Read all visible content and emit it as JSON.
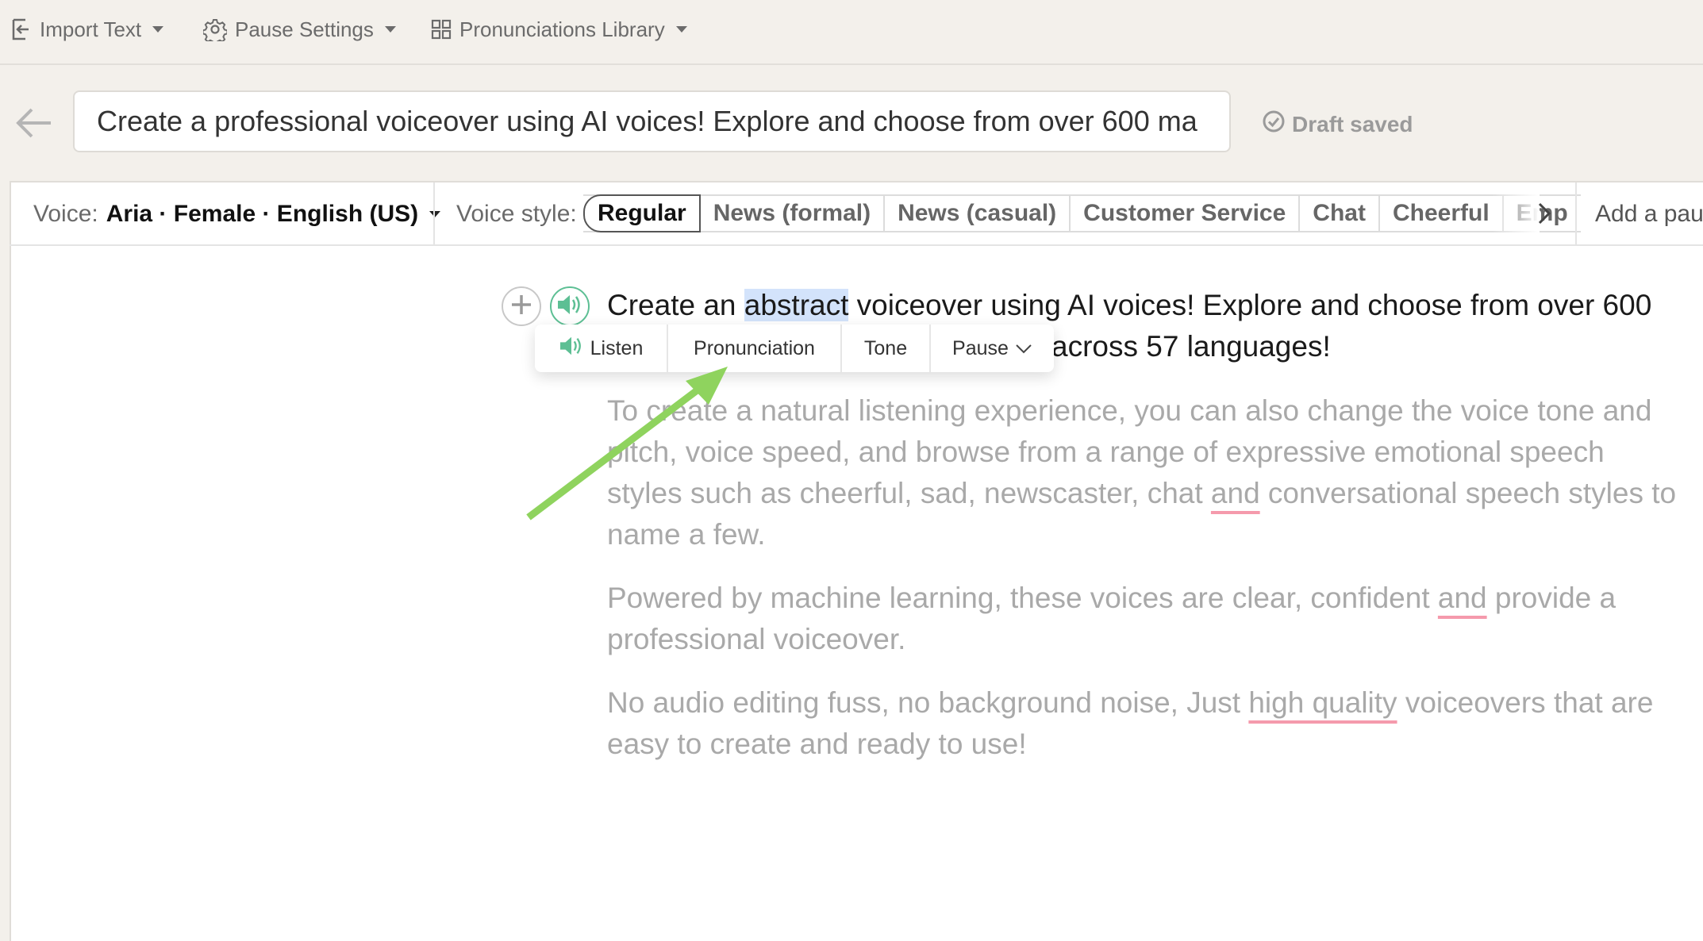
{
  "toolbar": {
    "items": [
      {
        "label": "Import Text",
        "icon": "import-icon"
      },
      {
        "label": "Pause Settings",
        "icon": "gear-icon"
      },
      {
        "label": "Pronunciations Library",
        "icon": "grid-icon"
      }
    ]
  },
  "title": {
    "value": "Create a professional voiceover using AI voices! Explore and choose from over 600 ma",
    "status": "Draft saved"
  },
  "voice_settings": {
    "voice_label": "Voice:",
    "voice_value": "Aria · Female · English (US)",
    "style_label": "Voice style:",
    "styles": [
      "Regular",
      "News (formal)",
      "News (casual)",
      "Customer Service",
      "Chat",
      "Cheerful",
      "Emp"
    ],
    "selected_style": "Regular",
    "add_pause": "Add a paus"
  },
  "editor": {
    "line1": {
      "before": "Create an ",
      "highlight": "abstract",
      "after": " voiceover using AI voices! Explore and choose from over 600"
    },
    "line2": "across 57 languages!",
    "paragraphs": [
      {
        "lines": [
          [
            "To create a natural listening experience, you can also change the voice tone and"
          ],
          [
            "pitch, voice speed, and browse from a range of expressive emotional speech"
          ],
          [
            "styles such as cheerful, sad, newscaster, chat ",
            "and",
            " conversational speech styles to"
          ],
          [
            "name a few."
          ]
        ]
      },
      {
        "lines": [
          [
            "Powered by machine learning, these voices are clear, confident ",
            "and",
            " provide a"
          ],
          [
            "professional voiceover."
          ]
        ]
      },
      {
        "lines": [
          [
            "No audio editing fuss, no background noise, Just ",
            "high quality",
            " voiceovers that are"
          ],
          [
            "easy to create and ready to use!"
          ]
        ]
      }
    ]
  },
  "popup": {
    "items": [
      "Listen",
      "Pronunciation",
      "Tone",
      "Pause"
    ]
  },
  "colors": {
    "accent_green": "#5dbf94",
    "annotation_arrow": "#8fd35e",
    "highlight": "#d3e3fb",
    "underline": "#f59aac"
  }
}
